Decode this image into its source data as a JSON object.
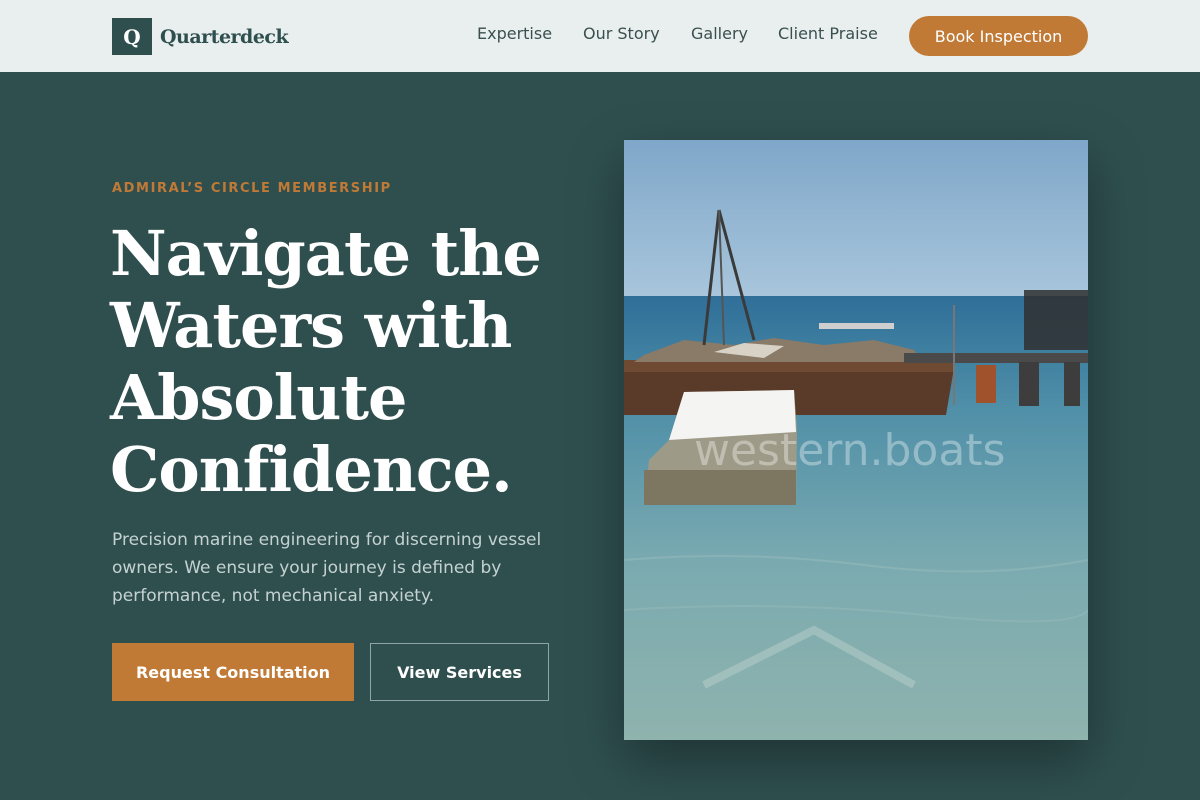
{
  "brand": {
    "mark": "Q",
    "name": "Quarterdeck"
  },
  "nav": {
    "items": [
      "Expertise",
      "Our Story",
      "Gallery",
      "Client Praise"
    ],
    "cta": "Book Inspection"
  },
  "hero": {
    "eyebrow": "ADMIRAL’S CIRCLE MEMBERSHIP",
    "headline_lines": [
      "Navigate the",
      "Waters with",
      "Absolute",
      "Confidence."
    ],
    "lede": "Precision marine engineering for discerning vessel owners. We ensure your journey is defined by performance, not mechanical anxiety.",
    "primary_cta": "Request Consultation",
    "secondary_cta": "View Services"
  },
  "photo": {
    "watermark": "western.boats",
    "subject": "harbor-barge-photo"
  },
  "colors": {
    "background": "#2f4f4f",
    "header": "#e9eeee",
    "accent": "#c07a36",
    "headline": "#ffffff"
  }
}
